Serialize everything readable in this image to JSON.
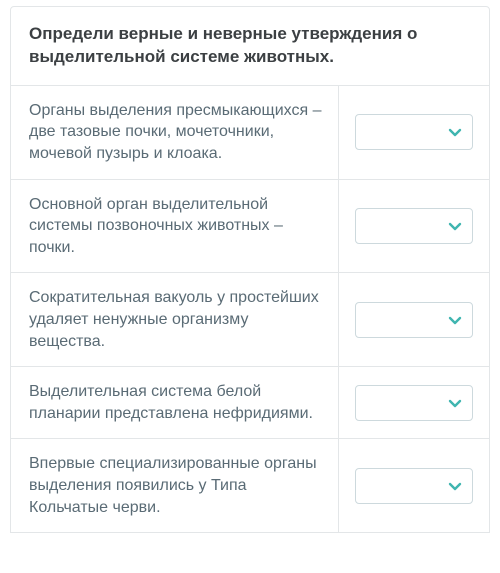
{
  "header": {
    "title": "Определи верные и неверные утверждения о выделительной системе животных."
  },
  "rows": [
    {
      "statement": "Органы выделения пресмыкающихся – две тазовые почки, мочеточники, мочевой пузырь и клоака.",
      "value": ""
    },
    {
      "statement": "Основной орган выделительной системы позвоночных животных – почки.",
      "value": ""
    },
    {
      "statement": "Сократительная вакуоль у простейших удаляет ненужные организму вещества.",
      "value": ""
    },
    {
      "statement": "Выделительная система белой планарии представлена нефридиями.",
      "value": ""
    },
    {
      "statement": "Впервые специализированные органы выделения появились у Типа Кольчатые черви.",
      "value": ""
    }
  ],
  "icons": {
    "chevron_down": "chevron-down-icon"
  }
}
